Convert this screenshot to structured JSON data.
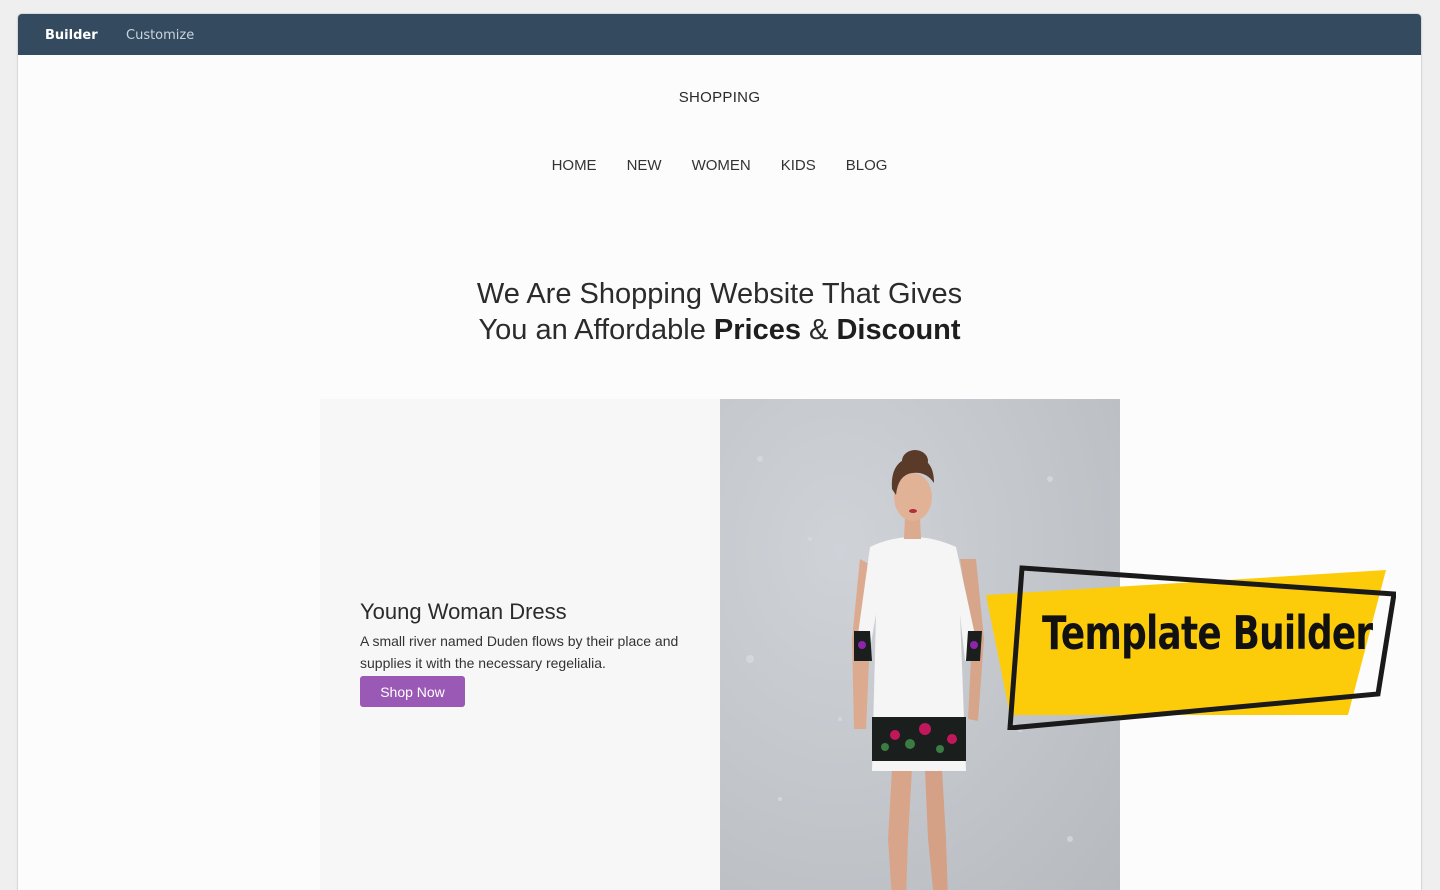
{
  "topbar": {
    "tabs": [
      {
        "label": "Builder",
        "active": true
      },
      {
        "label": "Customize",
        "active": false
      }
    ],
    "background": "#344a5f"
  },
  "site": {
    "title": "SHOPPING",
    "nav": [
      "HOME",
      "NEW",
      "WOMEN",
      "KIDS",
      "BLOG"
    ]
  },
  "headline": {
    "line1": "We Are Shopping Website That Gives",
    "line2_prefix": "You an Affordable ",
    "bold1": "Prices",
    "amp": " & ",
    "bold2": "Discount"
  },
  "product": {
    "title": "Young Woman Dress",
    "description": "A small river named Duden flows by their place and supplies it with the necessary regelialia.",
    "button_label": "Shop Now",
    "button_color": "#9b59b6",
    "photo": "woman-in-white-embroidered-dress"
  },
  "badge": {
    "text": "Template Builder",
    "color": "#fccc0a"
  }
}
